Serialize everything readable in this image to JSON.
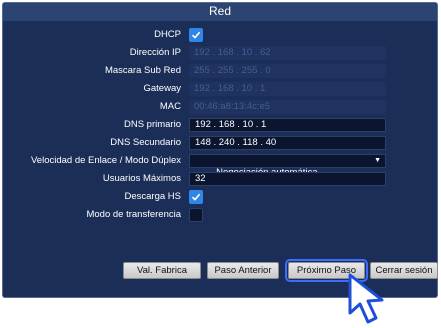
{
  "window": {
    "title": "Red"
  },
  "fields": {
    "dhcp": {
      "label": "DHCP",
      "checked": true
    },
    "ip": {
      "label": "Dirección IP",
      "value": "192 . 168 . 10 . 62"
    },
    "mask": {
      "label": "Mascara Sub Red",
      "value": "255 . 255 . 255 . 0"
    },
    "gateway": {
      "label": "Gateway",
      "value": "192 . 168 . 10 . 1"
    },
    "mac": {
      "label": "MAC",
      "value": "00:46:a8:13:4c:e5"
    },
    "dns1": {
      "label": "DNS primario",
      "value": "192 . 168 . 10 . 1"
    },
    "dns2": {
      "label": "DNS Secundario",
      "value": "148 . 240 . 118 . 40"
    },
    "speed": {
      "label": "Velocidad de  Enlace / Modo Dúplex",
      "value": "Negociación automática"
    },
    "max_users": {
      "label": "Usuarios Máximos",
      "value": "32"
    },
    "hs_download": {
      "label": "Descarga HS",
      "checked": true
    },
    "transfer_mode": {
      "label": "Modo de transferencia",
      "checked": false
    }
  },
  "buttons": {
    "defaults": "Val. Fabrica",
    "previous": "Paso Anterior",
    "next": "Próximo Paso",
    "logout": "Cerrar sesión"
  },
  "icons": {
    "checkbox": "check-icon",
    "pointer": "mouse-pointer-icon",
    "dropdown": "caret-down-icon"
  },
  "colors": {
    "panel": "#1b2e58",
    "checkbox_on": "#2f86e6",
    "focus": "#3c6cff"
  }
}
